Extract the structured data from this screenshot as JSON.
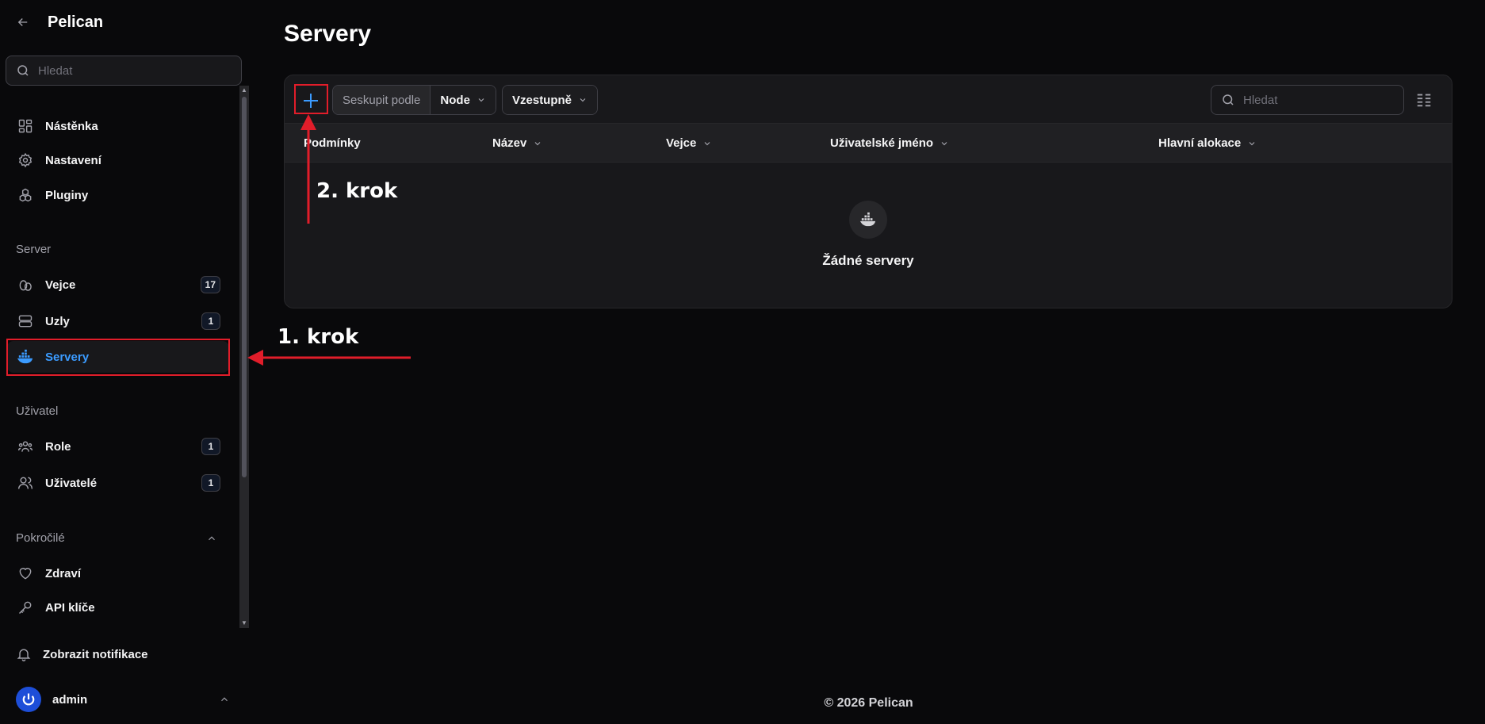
{
  "app": {
    "title": "Pelican"
  },
  "sidebar": {
    "search_placeholder": "Hledat",
    "top_items": [
      {
        "label": "Nástěnka",
        "icon": "dashboard-icon"
      },
      {
        "label": "Nastavení",
        "icon": "gear-icon"
      },
      {
        "label": "Pluginy",
        "icon": "puzzle-icon"
      }
    ],
    "groups": {
      "server": "Server",
      "user": "Uživatel",
      "advanced": "Pokročilé"
    },
    "server_items": [
      {
        "label": "Vejce",
        "icon": "egg-icon",
        "badge": "17"
      },
      {
        "label": "Uzly",
        "icon": "server-stack-icon",
        "badge": "1"
      },
      {
        "label": "Servery",
        "icon": "docker-icon",
        "active": true
      }
    ],
    "user_items": [
      {
        "label": "Role",
        "icon": "role-icon",
        "badge": "1"
      },
      {
        "label": "Uživatelé",
        "icon": "users-icon",
        "badge": "1"
      }
    ],
    "advanced_items": [
      {
        "label": "Zdraví",
        "icon": "heart-icon"
      },
      {
        "label": "API klíče",
        "icon": "key-icon"
      }
    ],
    "notifications_label": "Zobrazit notifikace",
    "user_name": "admin"
  },
  "main": {
    "title": "Servery",
    "toolbar": {
      "group_by_label": "Seskupit podle",
      "group_by_value": "Node",
      "sort_value": "Vzestupně",
      "search_placeholder": "Hledat"
    },
    "columns": [
      "Podmínky",
      "Název",
      "Vejce",
      "Uživatelské jméno",
      "Hlavní alokace"
    ],
    "empty_text": "Žádné servery"
  },
  "footer": "© 2026 Pelican",
  "annotations": {
    "step1": "1. krok",
    "step2": "2. krok",
    "color": "#e11d2a"
  },
  "colors": {
    "accent": "#3b9bff",
    "background": "#09090b",
    "panel": "#18181b"
  }
}
